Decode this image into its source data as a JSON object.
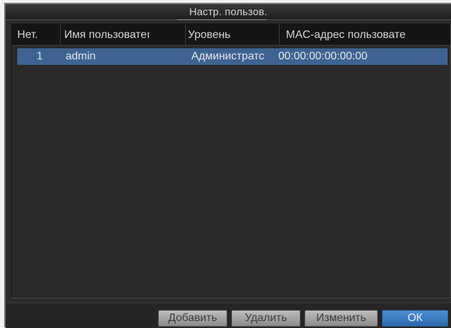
{
  "dialog": {
    "title": "Настр. пользов."
  },
  "table": {
    "headers": {
      "no": "Нет.",
      "username": "Имя пользоватеı",
      "level": "Уровень",
      "mac": "MAC-адрес пользовате"
    },
    "rows": [
      {
        "no": "1",
        "username": "admin",
        "level": "Администратс",
        "mac": "00:00:00:00:00:00"
      }
    ]
  },
  "buttons": {
    "add": "Добавить",
    "delete": "Удалить",
    "edit": "Изменить",
    "ok": "ОК"
  },
  "colors": {
    "selected_row": "#3e6391",
    "ok_button": "#3a7cc0"
  }
}
